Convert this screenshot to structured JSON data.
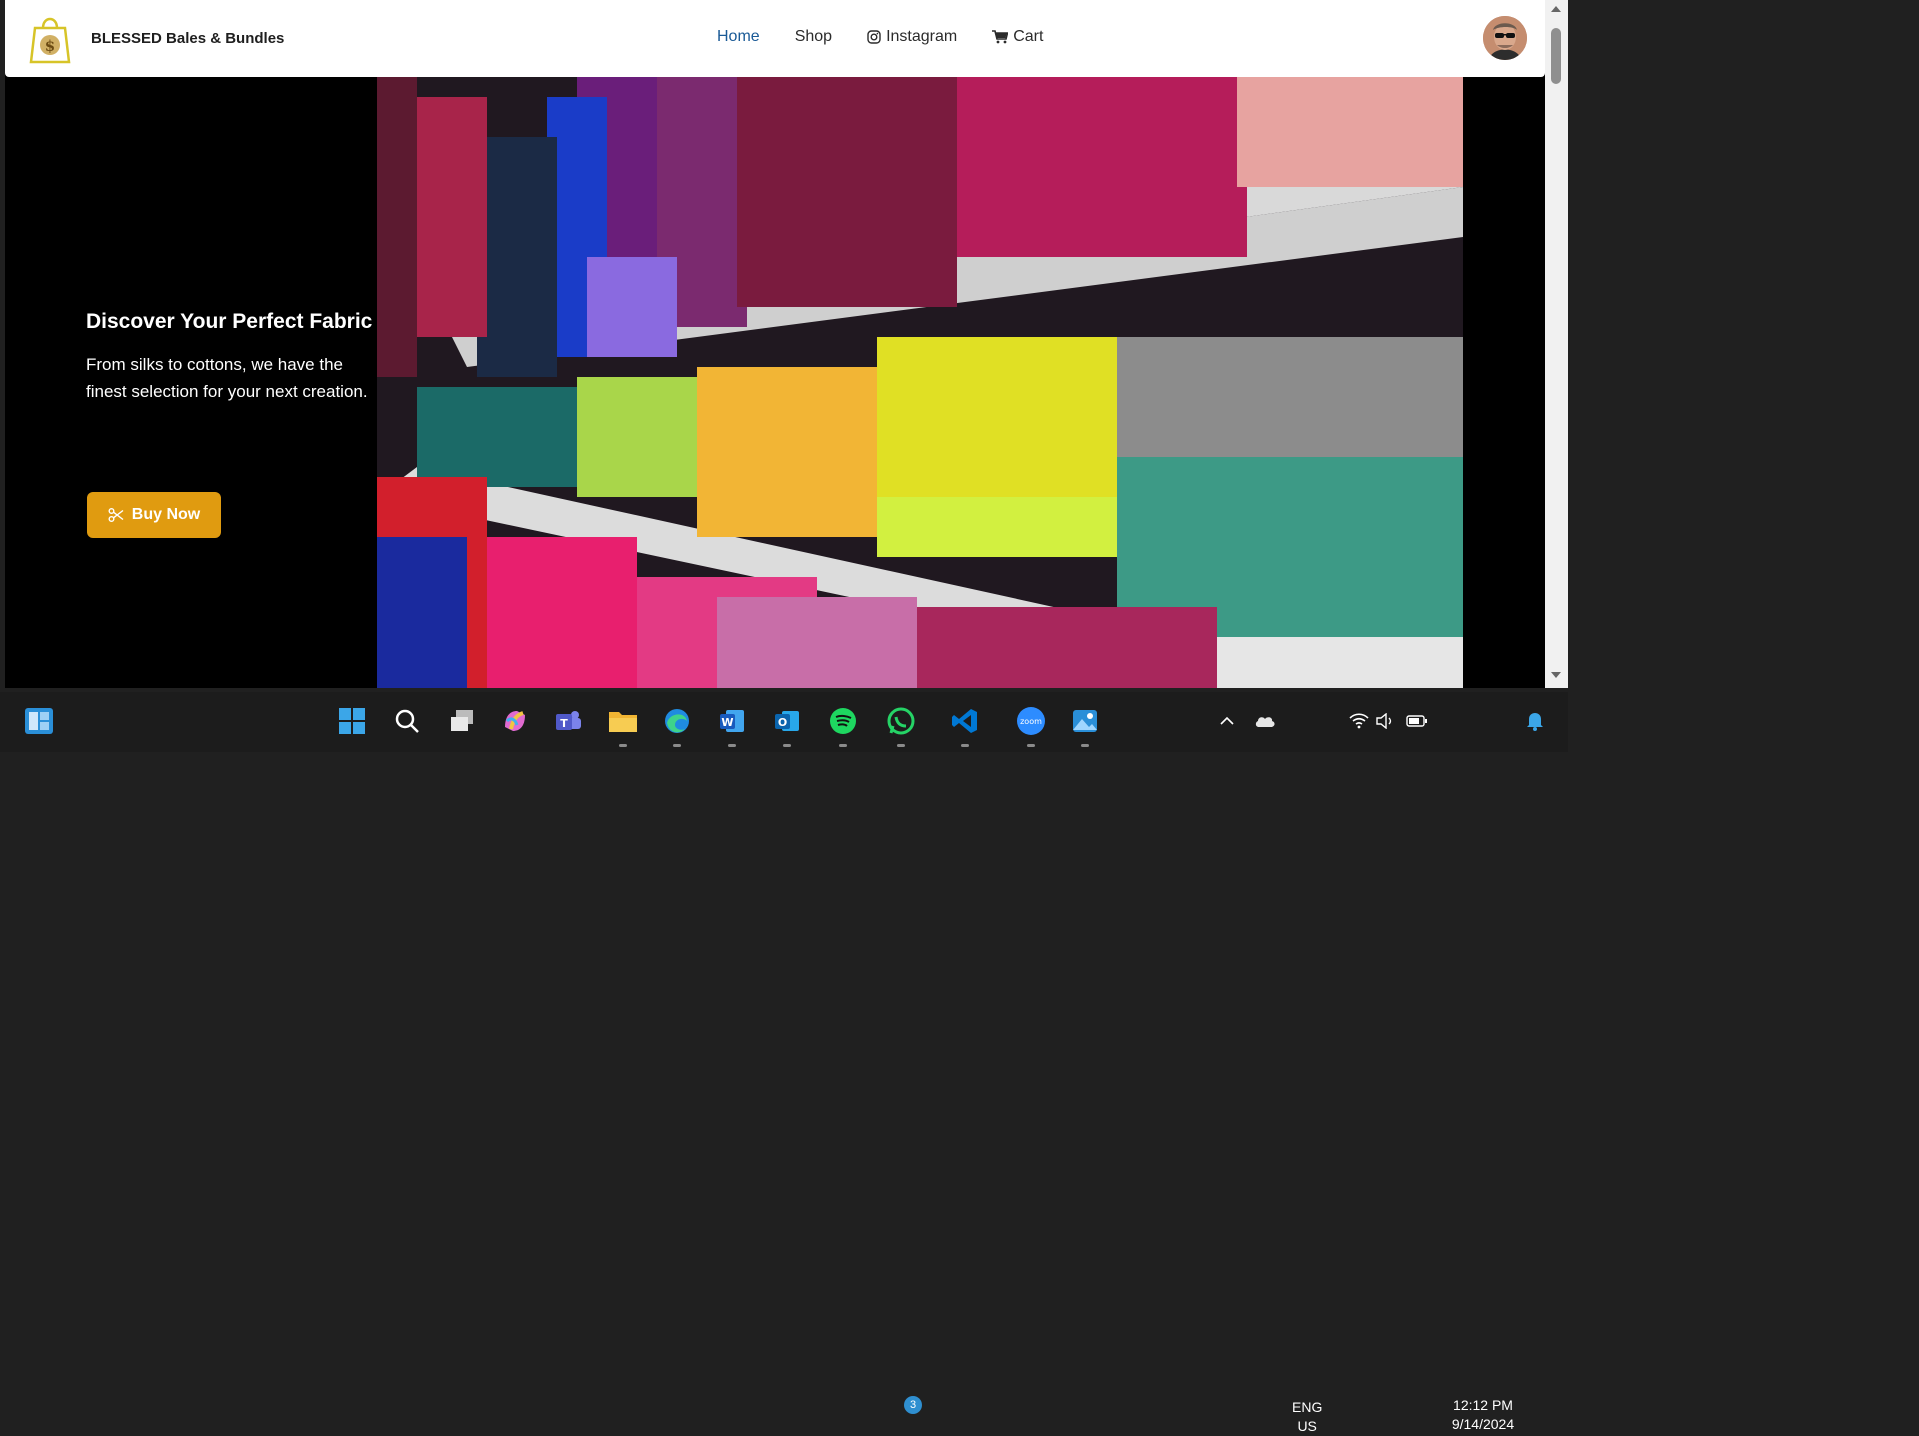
{
  "brand": {
    "name": "BLESSED Bales & Bundles"
  },
  "nav": {
    "home": "Home",
    "shop": "Shop",
    "instagram": "Instagram",
    "cart": "Cart"
  },
  "hero": {
    "title": "Discover Your Perfect Fabric",
    "subtitle": "From silks to cottons, we have the finest selection for your next creation.",
    "button": "Buy Now"
  },
  "taskbar": {
    "apps": [
      "widgets-icon",
      "start-icon",
      "search-icon",
      "task-view-icon",
      "copilot-icon",
      "teams-icon",
      "file-explorer-icon",
      "edge-icon",
      "word-icon",
      "outlook-icon",
      "spotify-icon",
      "whatsapp-icon",
      "vscode-icon",
      "zoom-icon",
      "photos-icon"
    ],
    "whatsapp_badge": "3",
    "zoom_label": "zoom",
    "lang_top": "ENG",
    "lang_bottom": "US",
    "time": "12:12 PM",
    "date": "9/14/2024"
  },
  "colors": {
    "accent": "#e09b10",
    "nav_active": "#1a5a96"
  }
}
